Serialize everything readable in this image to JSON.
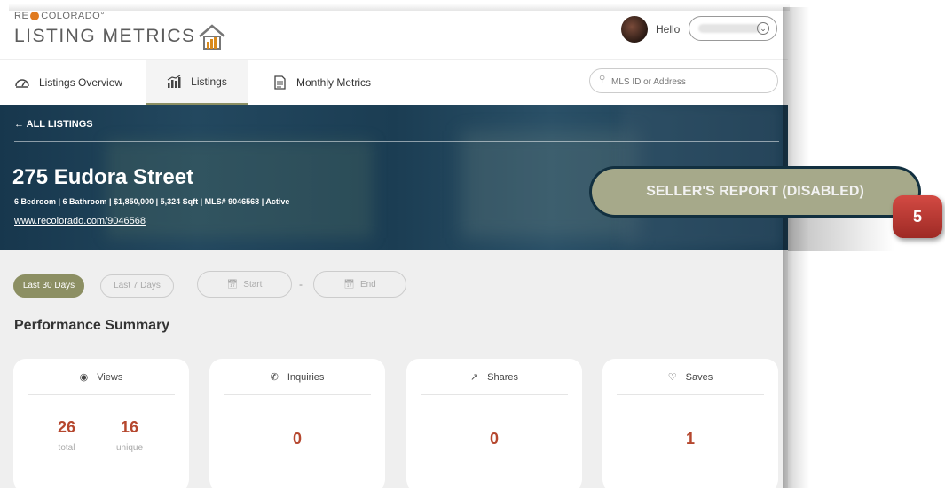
{
  "logo": {
    "top": "RE COLORADO",
    "main": "LISTING METRICS"
  },
  "user": {
    "greeting": "Hello"
  },
  "nav": {
    "tabs": [
      {
        "label": "Listings Overview"
      },
      {
        "label": "Listings"
      },
      {
        "label": "Monthly Metrics"
      }
    ],
    "search_placeholder": "MLS ID or Address"
  },
  "listing": {
    "back_label": "← ALL LISTINGS",
    "address": "275 Eudora Street",
    "details": "6 Bedroom | 6 Bathroom | $1,850,000 | 5,324 Sqft | MLS# 9046568 | Active",
    "url": "www.recolorado.com/9046568",
    "seller_report": "SELLER'S REPORT (DISABLED)"
  },
  "callout": "5",
  "filters": {
    "last30": "Last 30 Days",
    "last7": "Last 7 Days",
    "start": "Start",
    "separator": "-",
    "end": "End"
  },
  "summary": {
    "title": "Performance Summary",
    "cards": [
      {
        "label": "Views",
        "total": "26",
        "total_label": "total",
        "unique": "16",
        "unique_label": "unique"
      },
      {
        "label": "Inquiries",
        "value": "0"
      },
      {
        "label": "Shares",
        "value": "0"
      },
      {
        "label": "Saves",
        "value": "1"
      }
    ]
  },
  "colors": {
    "accent": "#8c8f63",
    "metric": "#b5472e",
    "hero": "#1b3d53",
    "callout": "#c0392b"
  }
}
